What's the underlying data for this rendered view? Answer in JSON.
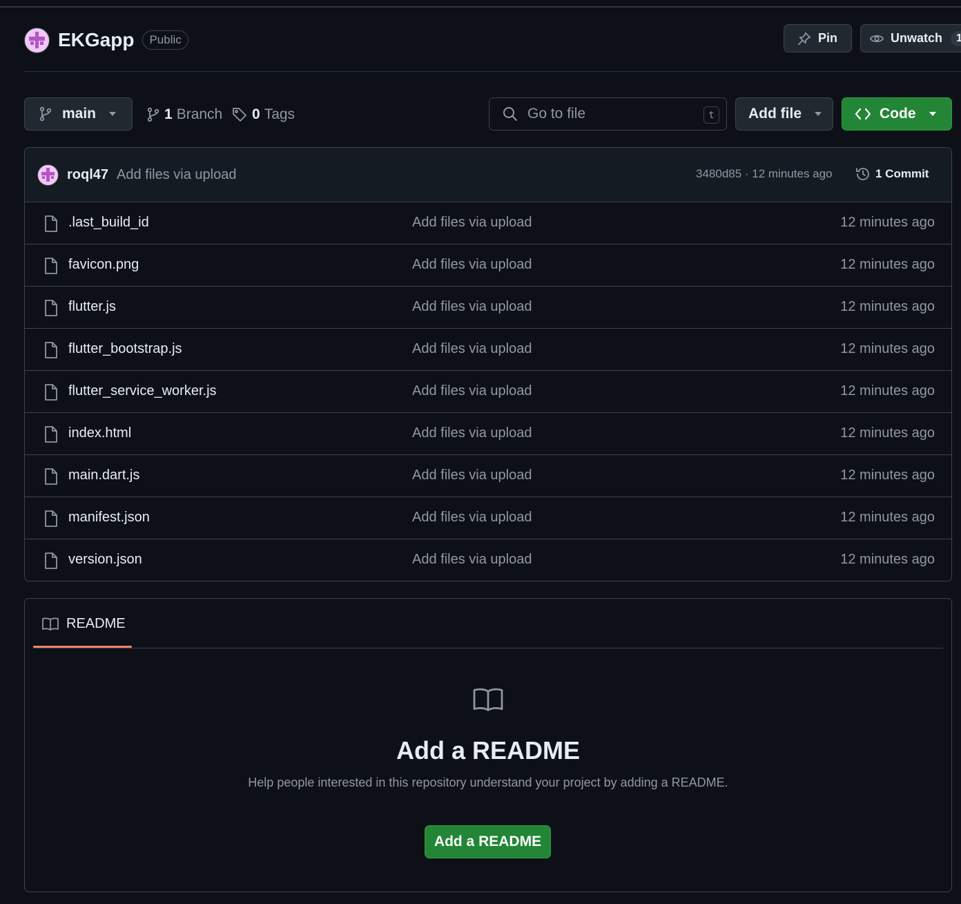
{
  "repo": {
    "name": "EKGapp",
    "visibility": "Public",
    "pin_label": "Pin",
    "unwatch_label": "Unwatch",
    "watch_count": "1"
  },
  "toolbar": {
    "branch": "main",
    "branches_count": "1",
    "branches_label": "Branch",
    "tags_count": "0",
    "tags_label": "Tags",
    "search_placeholder": "Go to file",
    "search_shortcut": "t",
    "add_file_label": "Add file",
    "code_label": "Code"
  },
  "latest_commit": {
    "author": "roql47",
    "message": "Add files via upload",
    "meta": "3480d85 · 12 minutes ago",
    "commit_count_label": "1 Commit"
  },
  "files": [
    {
      "name": ".last_build_id",
      "message": "Add files via upload",
      "time": "12 minutes ago"
    },
    {
      "name": "favicon.png",
      "message": "Add files via upload",
      "time": "12 minutes ago"
    },
    {
      "name": "flutter.js",
      "message": "Add files via upload",
      "time": "12 minutes ago"
    },
    {
      "name": "flutter_bootstrap.js",
      "message": "Add files via upload",
      "time": "12 minutes ago"
    },
    {
      "name": "flutter_service_worker.js",
      "message": "Add files via upload",
      "time": "12 minutes ago"
    },
    {
      "name": "index.html",
      "message": "Add files via upload",
      "time": "12 minutes ago"
    },
    {
      "name": "main.dart.js",
      "message": "Add files via upload",
      "time": "12 minutes ago"
    },
    {
      "name": "manifest.json",
      "message": "Add files via upload",
      "time": "12 minutes ago"
    },
    {
      "name": "version.json",
      "message": "Add files via upload",
      "time": "12 minutes ago"
    }
  ],
  "readme": {
    "tab_label": "README",
    "title": "Add a README",
    "description": "Help people interested in this repository understand your project by adding a README.",
    "button_label": "Add a README"
  },
  "icons": {
    "pin": "pin-icon",
    "eye": "eye-icon",
    "branch": "git-branch-icon",
    "tag": "tag-icon",
    "search": "search-icon",
    "code": "code-icon",
    "history": "history-icon",
    "file": "file-icon",
    "book": "book-icon",
    "caret": "triangle-down-icon"
  },
  "colors": {
    "background": "#0d1117",
    "border": "#3d444d",
    "primary_button": "#238636",
    "tab_underline": "#f78166",
    "muted_text": "#9198a1"
  }
}
